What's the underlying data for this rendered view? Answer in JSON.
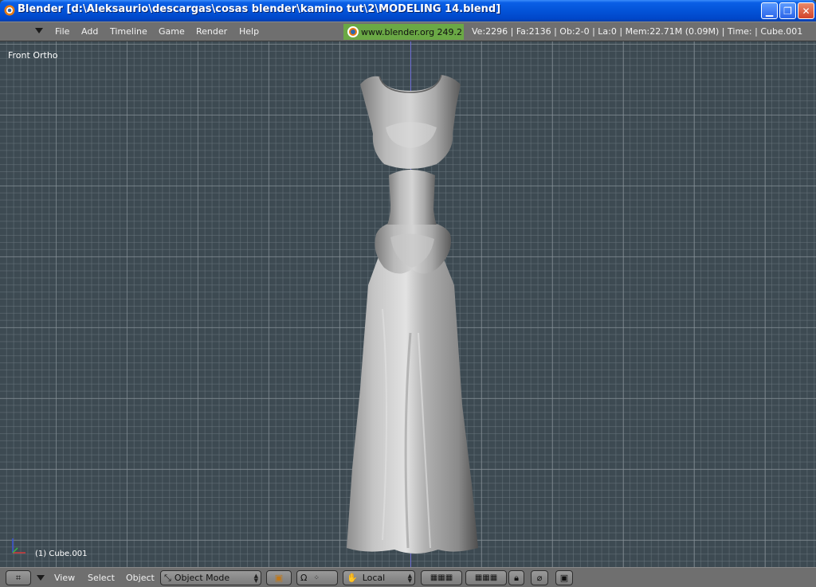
{
  "window": {
    "title": "Blender [d:\\Aleksaurio\\descargas\\cosas blender\\kamino tut\\2\\MODELING 14.blend]",
    "minimize_icon": "minimize-icon",
    "maximize_icon": "restore-icon",
    "close_icon": "close-icon"
  },
  "top_header": {
    "menu": [
      "File",
      "Add",
      "Timeline",
      "Game",
      "Render",
      "Help"
    ],
    "website": "www.blender.org 249.2",
    "stats": "Ve:2296 | Fa:2136 | Ob:2-0 | La:0  | Mem:22.71M (0.09M)  | Time: | Cube.001"
  },
  "viewport": {
    "view_name": "Front Ortho",
    "object_label": "(1) Cube.001"
  },
  "bottom_header": {
    "menu": [
      "View",
      "Select",
      "Object"
    ],
    "mode": "Object Mode",
    "orientation": "Local"
  },
  "colors": {
    "title_blue": "#0353d8",
    "header_grey": "#6f6f6f",
    "viewport_bg": "#3d4a52",
    "grid_line": "#8c969c",
    "logo_green": "#6aa845"
  }
}
